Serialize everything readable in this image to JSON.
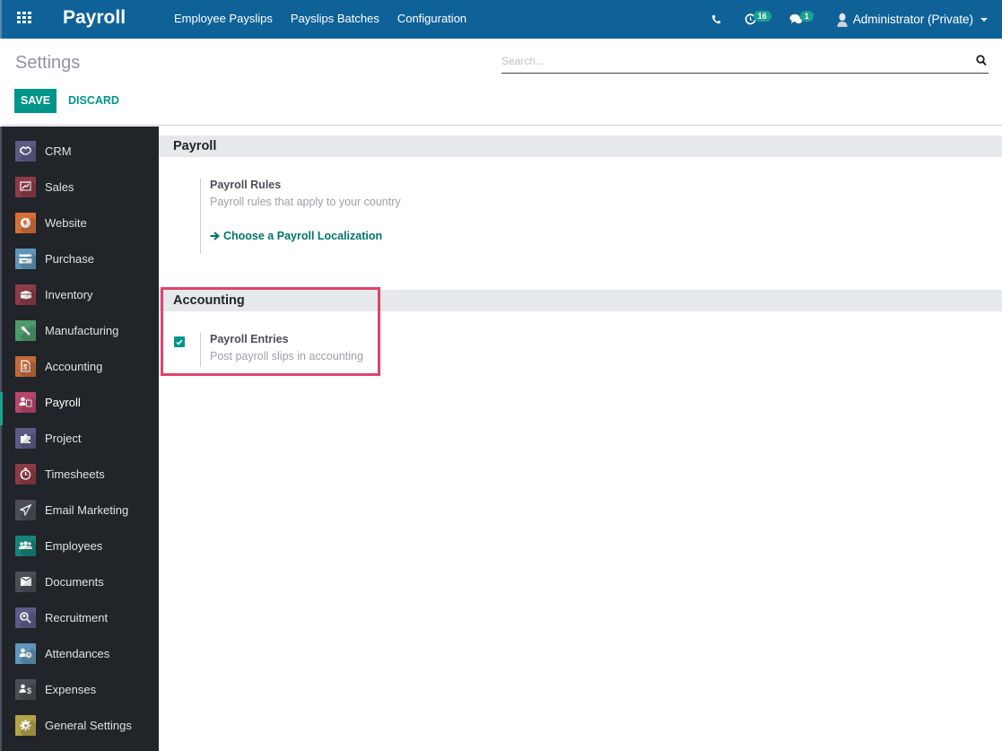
{
  "navbar": {
    "app_title": "Payroll",
    "menu": [
      "Employee Payslips",
      "Payslips Batches",
      "Configuration"
    ],
    "activities_count": "16",
    "messages_count": "1",
    "user": "Administrator (Private)",
    "color": "#0f6298"
  },
  "control_panel": {
    "title": "Settings",
    "save_label": "SAVE",
    "discard_label": "DISCARD",
    "search_placeholder": "Search..."
  },
  "sidebar": {
    "active": "Payroll",
    "items": [
      {
        "label": "CRM",
        "icon": "handshake-icon",
        "color": "#5d5b86"
      },
      {
        "label": "Sales",
        "icon": "chart-icon",
        "color": "#8c3b47"
      },
      {
        "label": "Website",
        "icon": "globe-icon",
        "color": "#d5703a"
      },
      {
        "label": "Purchase",
        "icon": "credit-card-icon",
        "color": "#5f96b9"
      },
      {
        "label": "Inventory",
        "icon": "box-icon",
        "color": "#8c3b47"
      },
      {
        "label": "Manufacturing",
        "icon": "wrench-icon",
        "color": "#4e9a6b"
      },
      {
        "label": "Accounting",
        "icon": "invoice-icon",
        "color": "#c46a3c"
      },
      {
        "label": "Payroll",
        "icon": "payroll-icon",
        "color": "#b8466c"
      },
      {
        "label": "Project",
        "icon": "puzzle-icon",
        "color": "#5d5b86"
      },
      {
        "label": "Timesheets",
        "icon": "stopwatch-icon",
        "color": "#8c3b47"
      },
      {
        "label": "Email Marketing",
        "icon": "paper-plane-icon",
        "color": "#4b4e54"
      },
      {
        "label": "Employees",
        "icon": "users-icon",
        "color": "#16837b"
      },
      {
        "label": "Documents",
        "icon": "folder-icon",
        "color": "#4b4e54"
      },
      {
        "label": "Recruitment",
        "icon": "search-user-icon",
        "color": "#5d5b86"
      },
      {
        "label": "Attendances",
        "icon": "user-clock-icon",
        "color": "#5f96b9"
      },
      {
        "label": "Expenses",
        "icon": "user-dollar-icon",
        "color": "#4b4e54"
      },
      {
        "label": "General Settings",
        "icon": "gear-icon",
        "color": "#b3a44c"
      }
    ]
  },
  "sections": {
    "payroll": {
      "title": "Payroll",
      "setting_title": "Payroll Rules",
      "setting_desc": "Payroll rules that apply to your country",
      "link_label": "Choose a Payroll Localization"
    },
    "accounting": {
      "title": "Accounting",
      "setting_title": "Payroll Entries",
      "setting_desc": "Post payroll slips in accounting",
      "checked": true
    }
  }
}
